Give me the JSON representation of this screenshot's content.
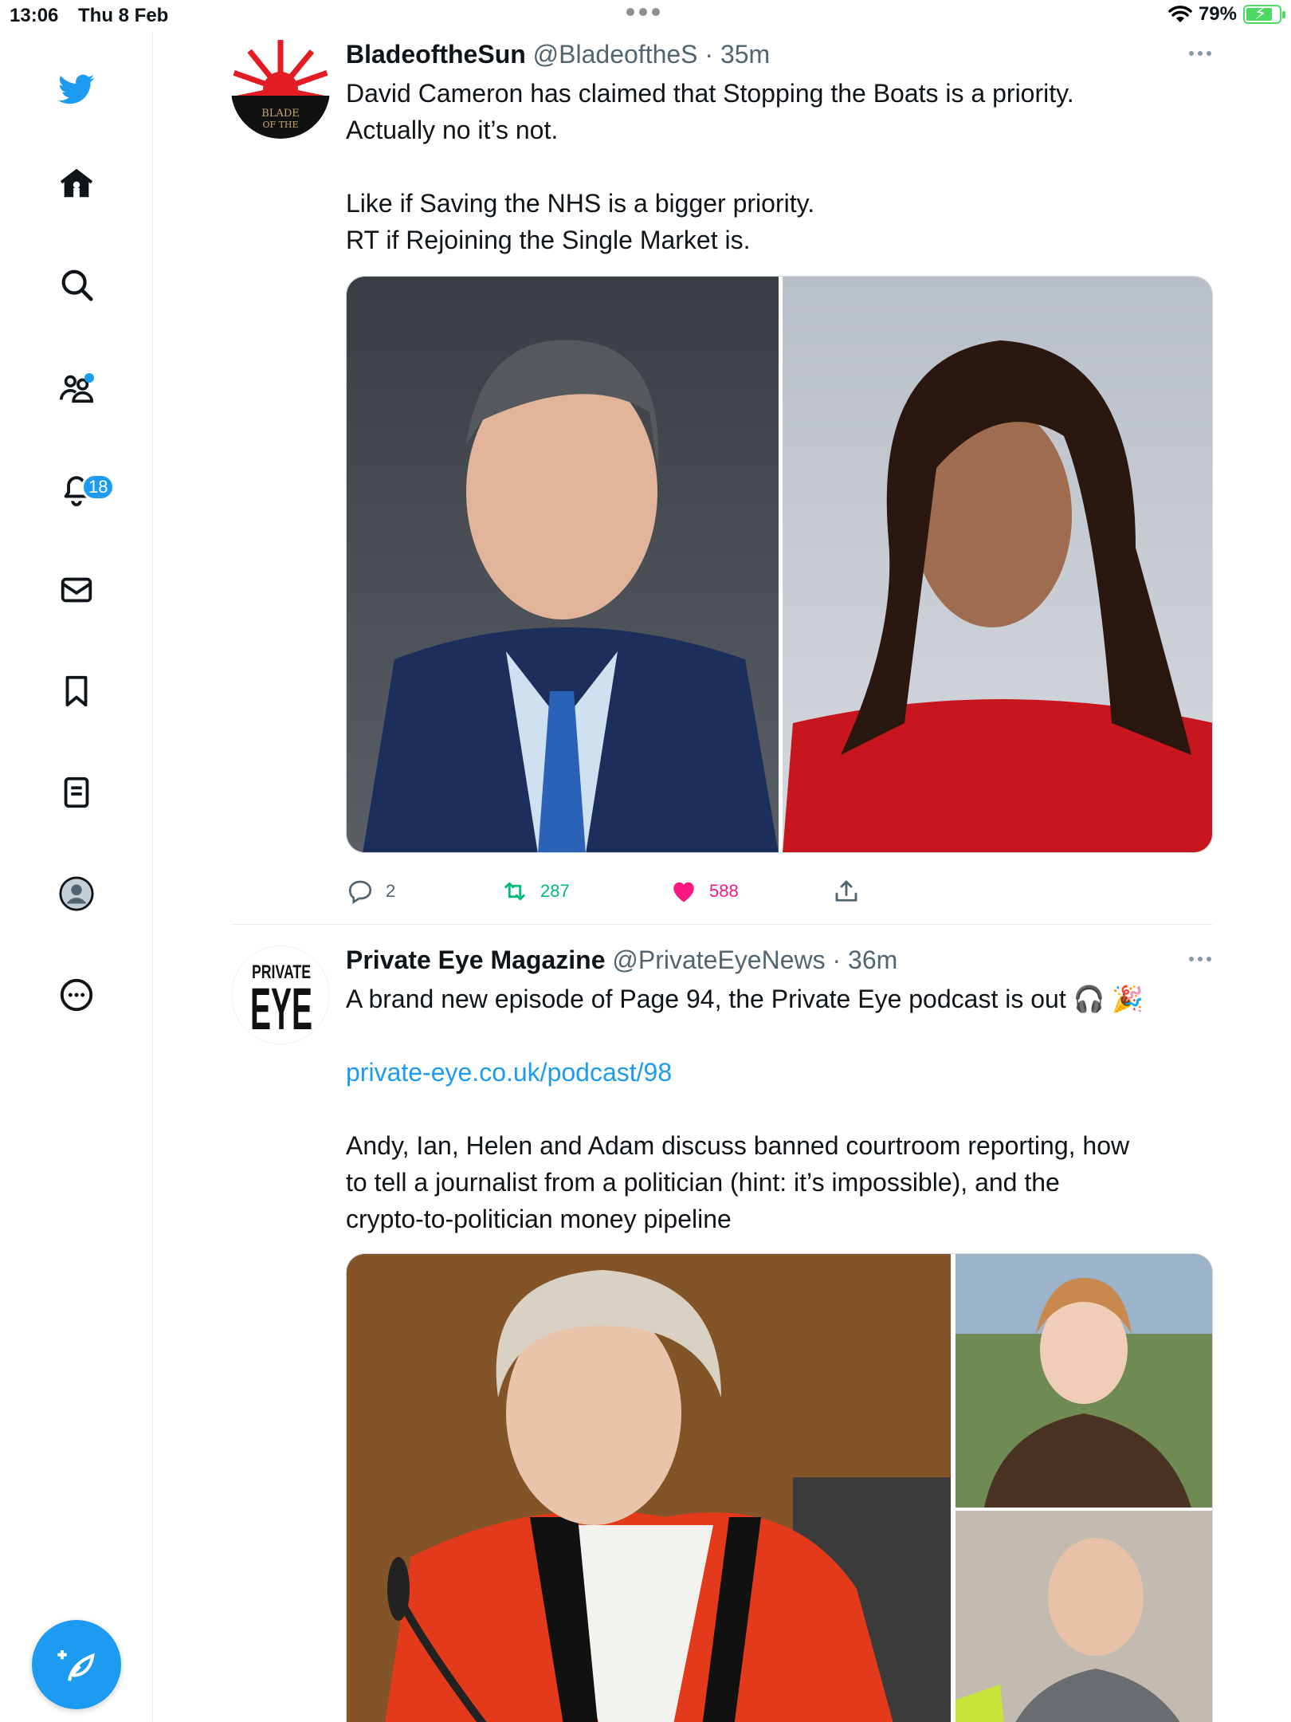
{
  "status_bar": {
    "time": "13:06",
    "date": "Thu 8 Feb",
    "battery_pct": "79%",
    "battery_level": 0.79
  },
  "sidebar": {
    "items": [
      {
        "name": "twitter-logo-icon"
      },
      {
        "name": "home-icon"
      },
      {
        "name": "search-icon"
      },
      {
        "name": "communities-icon"
      },
      {
        "name": "notifications-icon"
      },
      {
        "name": "messages-icon"
      },
      {
        "name": "bookmarks-icon"
      },
      {
        "name": "lists-icon"
      },
      {
        "name": "profile-icon"
      },
      {
        "name": "more-icon"
      }
    ],
    "notifications_badge": "18",
    "accent": "#1d9bf0"
  },
  "tweets": [
    {
      "name": "BladeoftheSun",
      "handle": "@BladeoftheS",
      "time": "· 35m",
      "avatar_text": "BLADE OF THE",
      "text": [
        "David Cameron has claimed that Stopping the Boats is a priority.",
        "Actually no it’s not.",
        "",
        "Like if Saving the NHS is a bigger priority.",
        "RT if Rejoining the Single Market is."
      ],
      "replies": "2",
      "retweets": "287",
      "likes": "588"
    },
    {
      "name": "Private Eye Magazine",
      "handle": "@PrivateEyeNews",
      "time": "· 36m",
      "avatar_line1": "PRIVATE",
      "avatar_line2": "EYE",
      "text_line1": "A brand new episode of Page 94, the Private Eye podcast is out 🎧 🎉",
      "link": "private-eye.co.uk/podcast/98",
      "text_para2": [
        "Andy, Ian, Helen and Adam discuss banned courtroom reporting, how",
        "to tell a journalist from a politician (hint: it’s impossible), and the",
        "crypto-to-politician money pipeline"
      ]
    }
  ]
}
